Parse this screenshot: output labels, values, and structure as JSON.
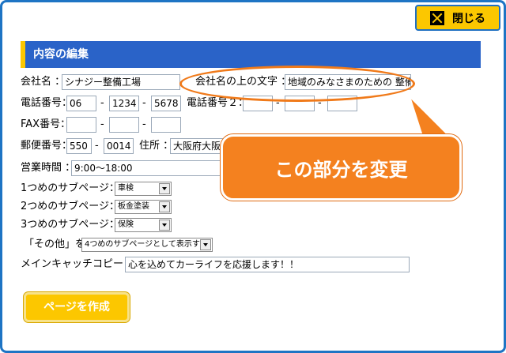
{
  "close_button": {
    "label": "閉じる"
  },
  "section": {
    "title": "内容の編集"
  },
  "fields": {
    "company_name_label": "会社名 ：",
    "company_name_value": "シナジー整備工場",
    "company_upper_label": "会社名の上の文字 ：",
    "company_upper_value": "地域のみなさまのための 整備工",
    "phone_label": "電話番号：",
    "phone1": "06",
    "phone2": "1234",
    "phone3": "5678",
    "phone2_label": "電話番号２：",
    "fax_label": "FAX番号：",
    "postal_label": "郵便番号：",
    "postal1": "550",
    "postal2": "0014",
    "address_label": "住所 ：",
    "address_value": "大阪府大阪",
    "hours_label": "営業時間 ：",
    "hours_value": "9:00～18:00",
    "sub1_label": "1つめのサブページ：",
    "sub1_value": "車検",
    "sub2_label": "2つめのサブページ：",
    "sub2_value": "板金塗装",
    "sub3_label": "3つめのサブページ：",
    "sub3_value": "保険",
    "other_label": "「その他」を",
    "other_value": "4つめのサブページとして表示する",
    "catch_label": "メインキャッチコピー：",
    "catch_value": "心を込めてカーライフを応援します！！",
    "dash": "-"
  },
  "callout": {
    "text": "この部分を変更"
  },
  "make_button": {
    "label": "ページを作成"
  },
  "colors": {
    "accent_blue": "#2a63c8",
    "yellow": "#fcc700",
    "orange": "#f4811f",
    "frame_blue": "#1e74c4"
  }
}
